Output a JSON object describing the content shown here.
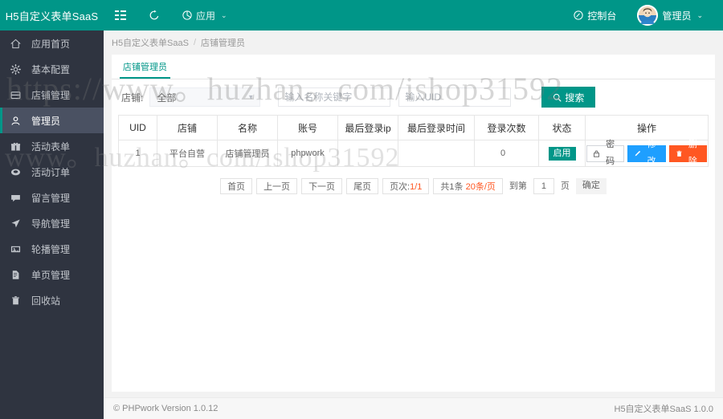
{
  "header": {
    "brand": "H5自定义表单SaaS",
    "menu_icon": "list-icon",
    "refresh_icon": "refresh-icon",
    "app_menu_label": "应用",
    "app_menu_icon": "cube-icon",
    "console_label": "控制台",
    "console_icon": "dashboard-icon",
    "user_label": "管理员",
    "avatar_icon": "user-avatar",
    "caret": "⌄",
    "bg_color": "#009688"
  },
  "sidebar": {
    "bg_color": "#2f3440",
    "active_color": "#009688",
    "items": [
      {
        "label": "应用首页",
        "icon": "home-icon",
        "active": false
      },
      {
        "label": "基本配置",
        "icon": "gear-icon",
        "active": false
      },
      {
        "label": "店铺管理",
        "icon": "shop-icon",
        "active": false
      },
      {
        "label": "管理员",
        "icon": "user-icon",
        "active": true
      },
      {
        "label": "活动表单",
        "icon": "gift-icon",
        "active": false
      },
      {
        "label": "活动订单",
        "icon": "order-icon",
        "active": false
      },
      {
        "label": "留言管理",
        "icon": "comment-icon",
        "active": false
      },
      {
        "label": "导航管理",
        "icon": "navigate-icon",
        "active": false
      },
      {
        "label": "轮播管理",
        "icon": "image-icon",
        "active": false
      },
      {
        "label": "单页管理",
        "icon": "page-icon",
        "active": false
      },
      {
        "label": "回收站",
        "icon": "trash-icon",
        "active": false
      }
    ]
  },
  "breadcrumb": {
    "root": "H5自定义表单SaaS",
    "separator": "/",
    "current": "店铺管理员"
  },
  "tabs": [
    {
      "label": "店铺管理员",
      "active": true
    }
  ],
  "filters": {
    "shop_label": "店铺:",
    "shop_value": "全部",
    "shop_caret": "▼",
    "name_placeholder": "输入名称关键字",
    "name_value": "",
    "uid_placeholder": "输入UID",
    "uid_value": "",
    "search_label": "搜索",
    "search_icon": "search-icon"
  },
  "table": {
    "columns": [
      "UID",
      "店铺",
      "名称",
      "账号",
      "最后登录ip",
      "最后登录时间",
      "登录次数",
      "状态",
      "操作"
    ],
    "rows": [
      {
        "uid": "1",
        "shop": "平台自营",
        "name": "店铺管理员",
        "account": "phpwork",
        "last_login_ip": "",
        "last_login_time": "",
        "login_count": "0",
        "status": "启用",
        "actions": [
          {
            "label": "密码",
            "icon": "lock-icon",
            "style": "pw"
          },
          {
            "label": "修改",
            "icon": "pencil-icon",
            "style": "edit"
          },
          {
            "label": "删除",
            "icon": "trash-icon",
            "style": "del"
          }
        ]
      }
    ]
  },
  "pagination": {
    "first": "首页",
    "prev": "上一页",
    "next": "下一页",
    "last": "尾页",
    "page_info_label": "页次:",
    "page_info_value": "1/1",
    "total_prefix": "共",
    "total_count": "1",
    "total_unit": "条",
    "per_page": "20",
    "per_page_unit": "条/页",
    "goto_label": "到第",
    "goto_value": "1",
    "goto_unit": "页",
    "confirm": "确定"
  },
  "footer": {
    "left": "© PHPwork Version 1.0.12",
    "right": "H5自定义表单SaaS 1.0.0"
  },
  "watermark": {
    "line1": "https://www.",
    "line2": "www。huzhan。com/ishop31592",
    "full_top": "https://www。huzhan。com/ishop31592"
  }
}
